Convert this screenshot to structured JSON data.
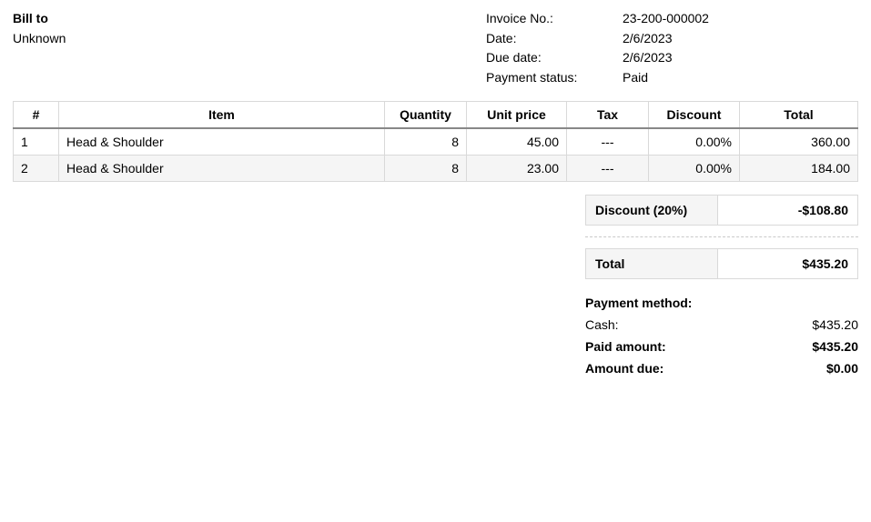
{
  "header": {
    "bill_to_label": "Bill to",
    "bill_to_value": "Unknown",
    "invoice_no_label": "Invoice No.:",
    "invoice_no_value": "23-200-000002",
    "date_label": "Date:",
    "date_value": "2/6/2023",
    "due_date_label": "Due date:",
    "due_date_value": "2/6/2023",
    "payment_status_label": "Payment status:",
    "payment_status_value": "Paid"
  },
  "table": {
    "columns": {
      "num": "#",
      "item": "Item",
      "qty": "Quantity",
      "price": "Unit price",
      "tax": "Tax",
      "discount": "Discount",
      "total": "Total"
    },
    "rows": [
      {
        "num": "1",
        "item": "Head & Shoulder",
        "qty": "8",
        "price": "45.00",
        "tax": "---",
        "discount": "0.00%",
        "total": "360.00"
      },
      {
        "num": "2",
        "item": "Head & Shoulder",
        "qty": "8",
        "price": "23.00",
        "tax": "---",
        "discount": "0.00%",
        "total": "184.00"
      }
    ]
  },
  "summary": {
    "discount_label": "Discount (20%)",
    "discount_value": "-$108.80",
    "total_label": "Total",
    "total_value": "$435.20",
    "payment_method_label": "Payment method:",
    "cash_label": "Cash:",
    "cash_value": "$435.20",
    "paid_amount_label": "Paid amount:",
    "paid_amount_value": "$435.20",
    "amount_due_label": "Amount due:",
    "amount_due_value": "$0.00"
  }
}
